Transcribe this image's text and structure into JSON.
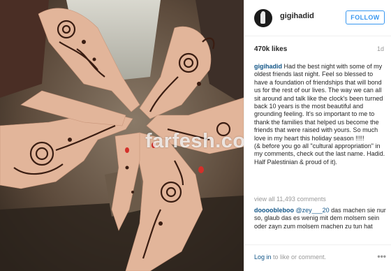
{
  "photo": {
    "watermark": "farfesh.com"
  },
  "header": {
    "username": "gigihadid",
    "follow_label": "FOLLOW"
  },
  "stats": {
    "likes": "470k likes",
    "age": "1d"
  },
  "caption": {
    "username": "gigihadid",
    "text": " Had the best night with some of my oldest friends last night. Feel so blessed to have a foundation of friendships that will bond us for the rest of our lives. The way we can all sit around and talk like the clock's been turned back 10 years is the most beautiful and grounding feeling. It's so important to me to thank the families that helped us become the friends that were raised with yours. So much love in my heart this holiday season !!!!!\n(& before you go all \"cultural appropriation\" in my comments, check out the last name. Hadid. Half Palestinian & proud of it)."
  },
  "comments": {
    "view_all": "view all 11,493 comments",
    "items": [
      {
        "username": "doooobleboo",
        "mention": "@zey___20",
        "text": " das machen sie nur so, glaub das es wenig mit dem molsem sein oder zayn zum molsem machen zu tun hat"
      }
    ]
  },
  "footer": {
    "login_link": "Log in",
    "login_rest": " to like or comment.",
    "more_icon": "more-options-icon"
  }
}
